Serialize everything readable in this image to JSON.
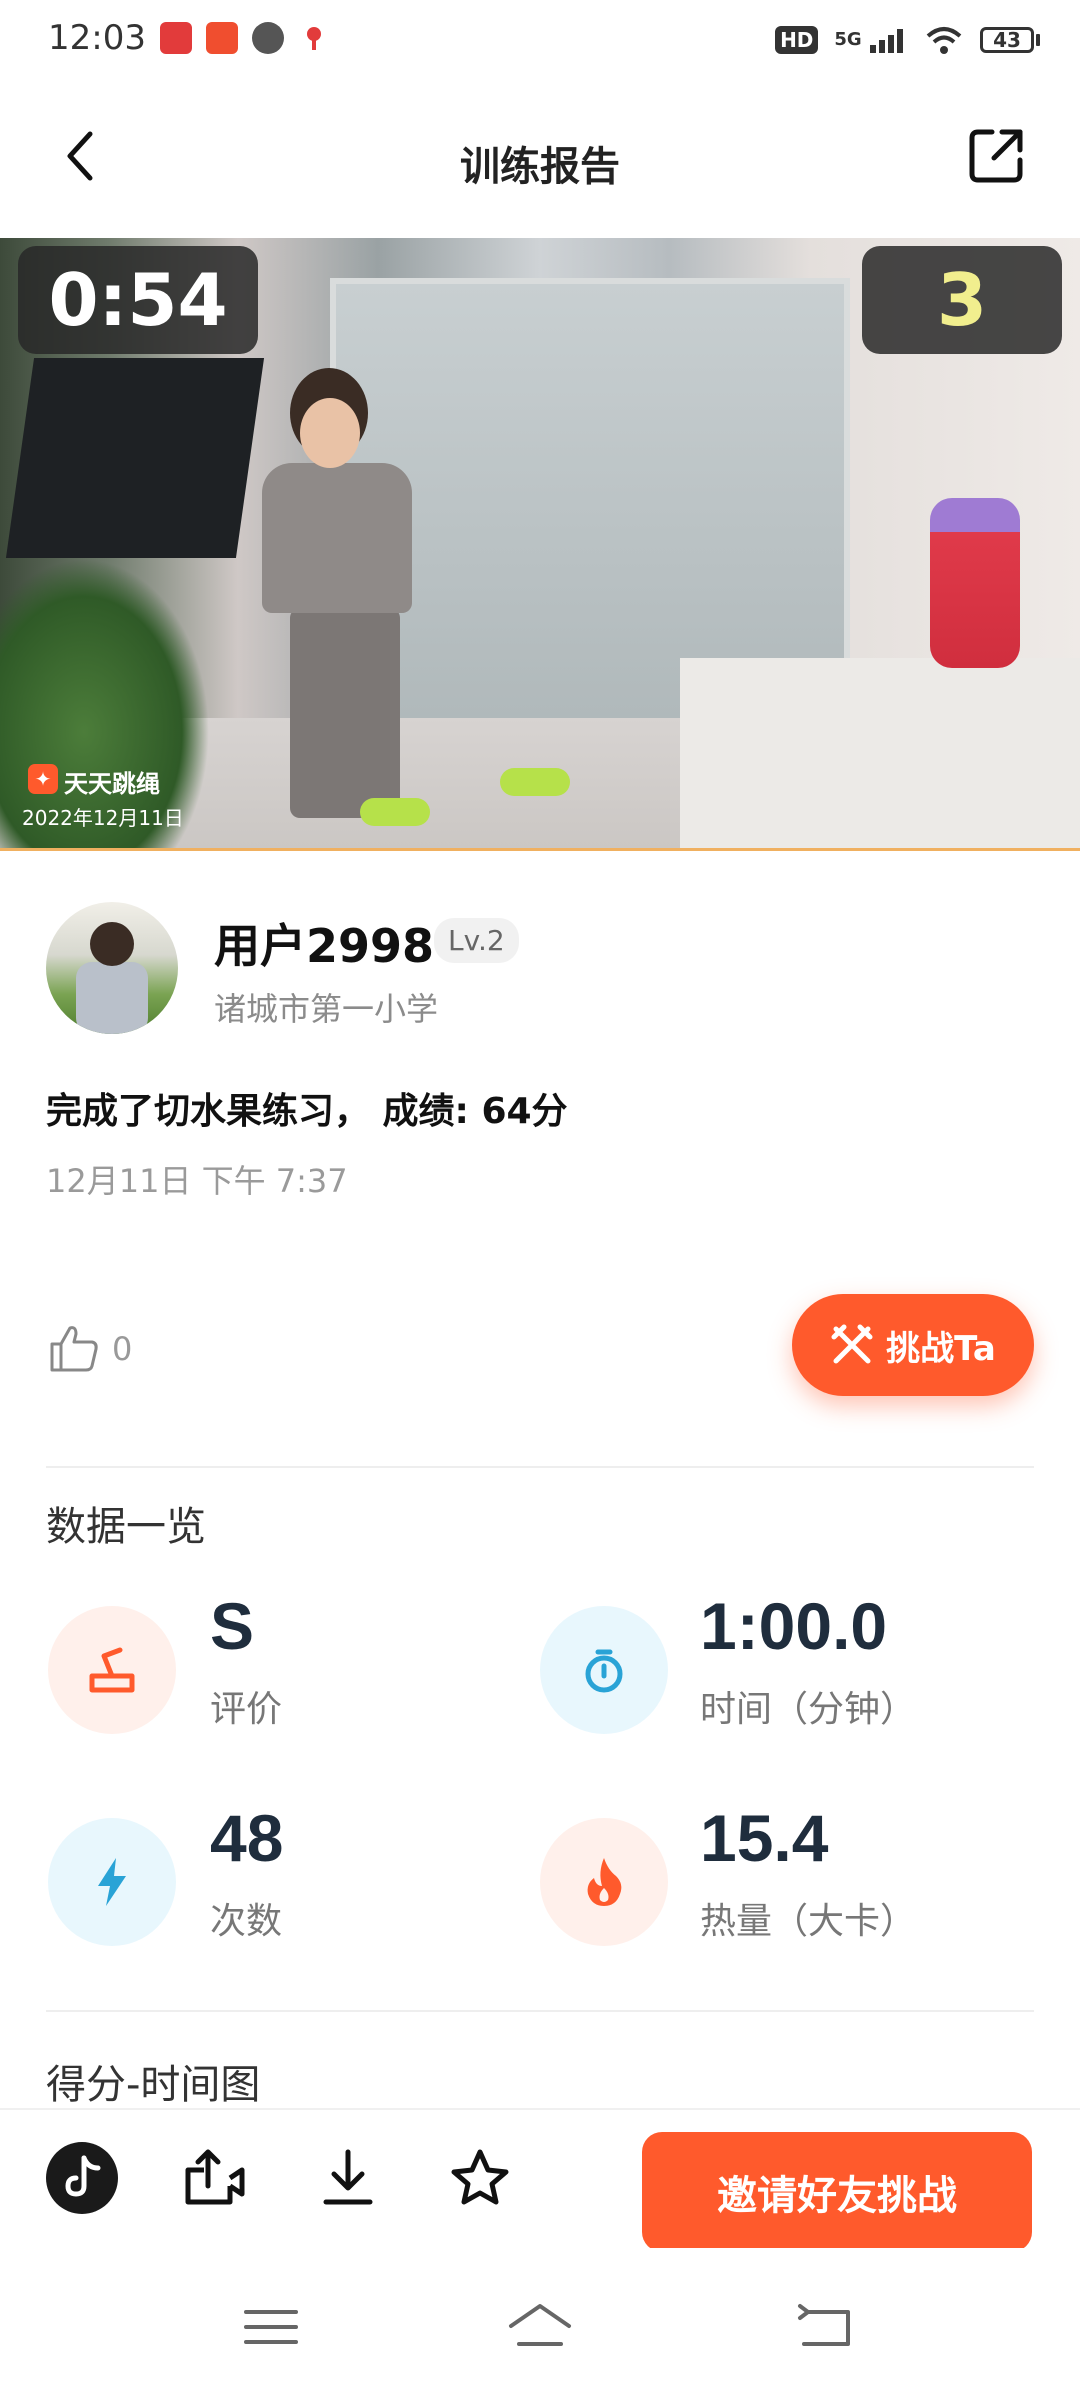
{
  "status_bar": {
    "time": "12:03",
    "network": "5G",
    "hd": "HD",
    "battery": "43"
  },
  "header": {
    "title": "训练报告"
  },
  "video": {
    "timer": "0:54",
    "count": "3",
    "watermark_app": "天天跳绳",
    "watermark_date": "2022年12月11日"
  },
  "user": {
    "name": "用户2998",
    "level": "Lv.2",
    "school": "诸城市第一小学"
  },
  "result": {
    "summary": "完成了切水果练习， 成绩: 64分",
    "datetime": "12月11日 下午 7:37"
  },
  "actions": {
    "like_count": "0",
    "challenge_label": "挑战Ta"
  },
  "overview": {
    "title": "数据一览",
    "stats": [
      {
        "value": "S",
        "label": "评价",
        "icon": "rating-icon",
        "color": "#ff5a2c",
        "bg": "#fff0eb"
      },
      {
        "value": "1:00.0",
        "label": "时间（分钟）",
        "icon": "stopwatch-icon",
        "color": "#29a3d6",
        "bg": "#e8f7fd"
      },
      {
        "value": "48",
        "label": "次数",
        "icon": "lightning-icon",
        "color": "#29a3d6",
        "bg": "#e8f7fd"
      },
      {
        "value": "15.4",
        "label": "热量（大卡）",
        "icon": "flame-icon",
        "color": "#ff5a2c",
        "bg": "#fff0eb"
      }
    ]
  },
  "chart_section": {
    "title": "得分-时间图"
  },
  "bottom_bar": {
    "invite_label": "邀请好友挑战"
  },
  "colors": {
    "accent": "#ff5a2c",
    "blue": "#29a3d6"
  }
}
